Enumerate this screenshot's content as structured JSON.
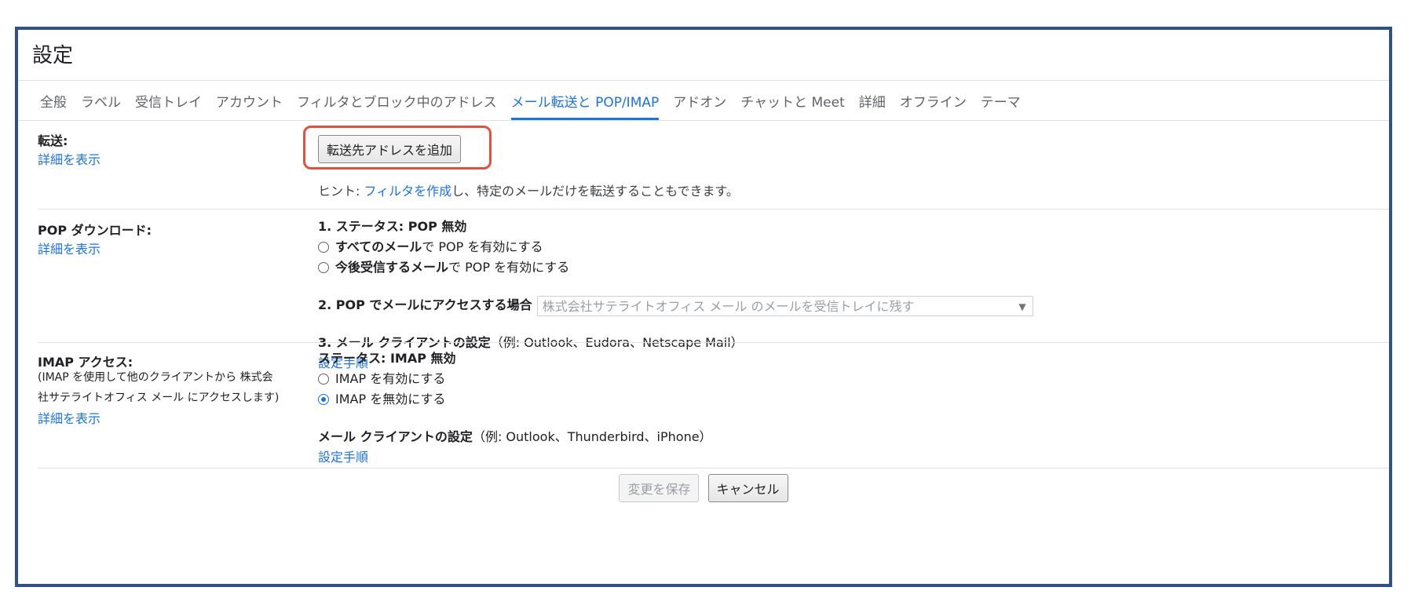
{
  "page": {
    "title": "設定"
  },
  "tabs": [
    {
      "label": "全般"
    },
    {
      "label": "ラベル"
    },
    {
      "label": "受信トレイ"
    },
    {
      "label": "アカウント"
    },
    {
      "label": "フィルタとブロック中のアドレス"
    },
    {
      "label": "メール転送と POP/IMAP",
      "active": true
    },
    {
      "label": "アドオン"
    },
    {
      "label": "チャットと Meet"
    },
    {
      "label": "詳細"
    },
    {
      "label": "オフライン"
    },
    {
      "label": "テーマ"
    }
  ],
  "forwarding": {
    "label": "転送:",
    "details_link": "詳細を表示",
    "add_button": "転送先アドレスを追加",
    "hint_prefix": "ヒント: ",
    "hint_link": "フィルタを作成",
    "hint_suffix": "し、特定のメールだけを転送することもできます。"
  },
  "pop": {
    "label": "POP ダウンロード:",
    "details_link": "詳細を表示",
    "status": "1. ステータス: POP 無効",
    "option1_bold": "すべてのメール",
    "option1_rest": "で POP を有効にする",
    "option2_bold": "今後受信するメール",
    "option2_rest": "で POP を有効にする",
    "access_label": "2. POP でメールにアクセスする場合",
    "access_select": "株式会社サテライトオフィス メール のメールを受信トレイに残す",
    "client_label": "3. メール クライアントの設定",
    "client_examples": "（例: Outlook、Eudora、Netscape Mail）",
    "setup_link": "設定手順"
  },
  "imap": {
    "label": "IMAP アクセス:",
    "description_line1": "(IMAP を使用して他のクライアントから 株式会",
    "description_line2": "社サテライトオフィス メール にアクセスします)",
    "details_link": "詳細を表示",
    "status": "ステータス: IMAP 無効",
    "option_enable": "IMAP を有効にする",
    "option_disable": "IMAP を無効にする",
    "selected": "disable",
    "client_label": "メール クライアントの設定",
    "client_examples": "（例: Outlook、Thunderbird、iPhone）",
    "setup_link": "設定手順"
  },
  "footer": {
    "save_label": "変更を保存",
    "cancel_label": "キャンセル"
  },
  "colors": {
    "accent": "#1a73e8",
    "frame_border": "#2f4f8f",
    "highlight": "#e2513d"
  }
}
